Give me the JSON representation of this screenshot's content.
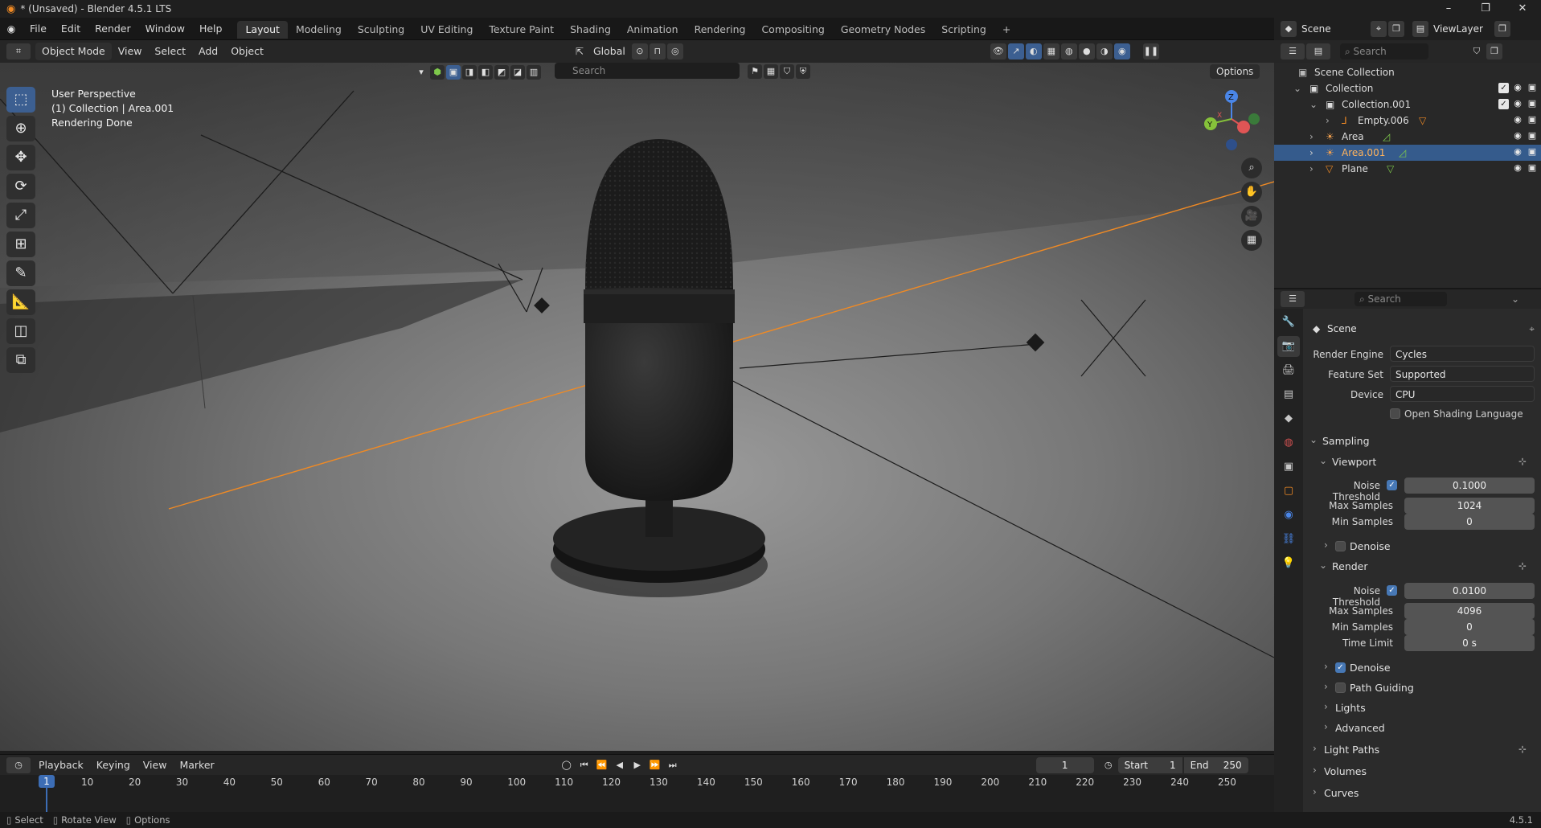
{
  "window": {
    "title": "* (Unsaved) - Blender 4.5.1 LTS",
    "minimize": "–",
    "maximize": "❐",
    "close": "✕"
  },
  "menubar": {
    "menus": [
      "File",
      "Edit",
      "Render",
      "Window",
      "Help"
    ],
    "workspaces": [
      "Layout",
      "Modeling",
      "Sculpting",
      "UV Editing",
      "Texture Paint",
      "Shading",
      "Animation",
      "Rendering",
      "Compositing",
      "Geometry Nodes",
      "Scripting"
    ],
    "add_workspace": "+",
    "scene_label": "Scene",
    "viewlayer_label": "ViewLayer"
  },
  "viewport_header": {
    "mode": "Object Mode",
    "menus": [
      "View",
      "Select",
      "Add",
      "Object"
    ],
    "transform_orientation": "Global",
    "search_placeholder": "Search",
    "options": "Options"
  },
  "viewport_info": {
    "line1": "User Perspective",
    "line2": "(1) Collection | Area.001",
    "line3": "Rendering Done"
  },
  "gizmo": {
    "z": "Z",
    "y": "Y",
    "x": "X"
  },
  "outliner": {
    "search_placeholder": "Search",
    "items": [
      {
        "label": "Scene Collection",
        "indent": 0,
        "icon": "scene-collection-icon"
      },
      {
        "label": "Collection",
        "indent": 1,
        "icon": "collection-icon"
      },
      {
        "label": "Collection.001",
        "indent": 2,
        "icon": "collection-icon"
      },
      {
        "label": "Empty.006",
        "indent": 3,
        "icon": "empty-icon"
      },
      {
        "label": "Area",
        "indent": 2,
        "icon": "light-icon"
      },
      {
        "label": "Area.001",
        "indent": 2,
        "icon": "light-icon"
      },
      {
        "label": "Plane",
        "indent": 2,
        "icon": "mesh-icon"
      }
    ]
  },
  "properties": {
    "search_placeholder": "Search",
    "context": "Scene",
    "render_engine_label": "Render Engine",
    "render_engine_value": "Cycles",
    "feature_set_label": "Feature Set",
    "feature_set_value": "Supported",
    "device_label": "Device",
    "device_value": "CPU",
    "osl_label": "Open Shading Language",
    "sampling": "Sampling",
    "viewport": "Viewport",
    "noise_threshold_label": "Noise Threshold",
    "vp_noise_threshold": "0.1000",
    "max_samples_label": "Max Samples",
    "vp_max_samples": "1024",
    "min_samples_label": "Min Samples",
    "vp_min_samples": "0",
    "denoise_label": "Denoise",
    "render": "Render",
    "r_noise_threshold": "0.0100",
    "r_max_samples": "4096",
    "r_min_samples": "0",
    "time_limit_label": "Time Limit",
    "r_time_limit": "0 s",
    "path_guiding": "Path Guiding",
    "lights": "Lights",
    "advanced": "Advanced",
    "light_paths": "Light Paths",
    "volumes": "Volumes",
    "curves": "Curves"
  },
  "timeline": {
    "menus": [
      "Playback",
      "Keying",
      "View",
      "Marker"
    ],
    "current_frame": "1",
    "start_label": "Start",
    "start_value": "1",
    "end_label": "End",
    "end_value": "250",
    "ticks": [
      "1",
      "10",
      "20",
      "30",
      "40",
      "50",
      "60",
      "70",
      "80",
      "90",
      "100",
      "110",
      "120",
      "130",
      "140",
      "150",
      "160",
      "170",
      "180",
      "190",
      "200",
      "210",
      "220",
      "230",
      "240",
      "250"
    ]
  },
  "statusbar": {
    "select": "Select",
    "rotate": "Rotate View",
    "options": "Options",
    "version": "4.5.1"
  }
}
